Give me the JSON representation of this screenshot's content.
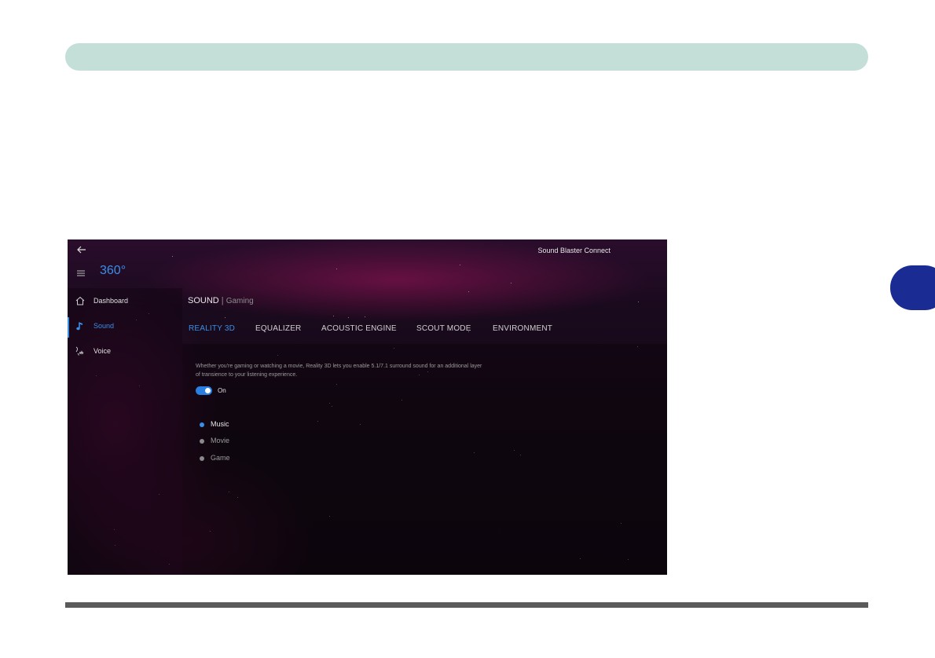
{
  "app": {
    "title": "Sound Blaster Connect",
    "brand": "360°"
  },
  "sidebar": {
    "items": [
      {
        "label": "Dashboard",
        "icon": "home-icon",
        "active": false
      },
      {
        "label": "Sound",
        "icon": "music-note-icon",
        "active": true
      },
      {
        "label": "Voice",
        "icon": "voice-icon",
        "active": false
      }
    ]
  },
  "section": {
    "title": "SOUND",
    "separator": "|",
    "subtitle": "Gaming"
  },
  "tabs": [
    {
      "label": "REALITY 3D",
      "active": true
    },
    {
      "label": "EQUALIZER",
      "active": false
    },
    {
      "label": "ACOUSTIC ENGINE",
      "active": false
    },
    {
      "label": "SCOUT MODE",
      "active": false
    },
    {
      "label": "ENVIRONMENT",
      "active": false
    }
  ],
  "reality3d": {
    "description": "Whether you're gaming or watching a movie, Reality 3D lets you enable 5.1/7.1 surround sound for an additional layer of transience to your listening experience.",
    "toggle_label": "On",
    "toggle_on": true,
    "modes": [
      {
        "label": "Music",
        "selected": true
      },
      {
        "label": "Movie",
        "selected": false
      },
      {
        "label": "Game",
        "selected": false
      }
    ]
  },
  "colors": {
    "accent": "#3a8ee6",
    "top_bar": "#c4ded8",
    "chapter_tab": "#1a2c93",
    "rule": "#5a5a5a"
  }
}
